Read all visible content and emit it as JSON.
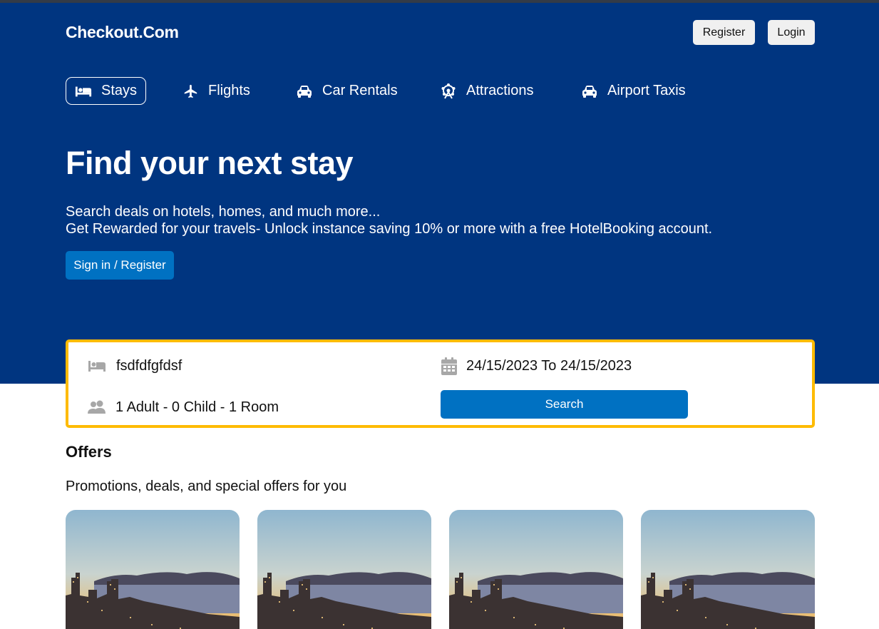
{
  "header": {
    "brand": "Checkout.Com",
    "register_label": "Register",
    "login_label": "Login"
  },
  "nav": {
    "items": [
      {
        "label": "Stays",
        "icon": "bed-icon",
        "active": true
      },
      {
        "label": "Flights",
        "icon": "plane-icon",
        "active": false
      },
      {
        "label": "Car Rentals",
        "icon": "car-icon",
        "active": false
      },
      {
        "label": "Attractions",
        "icon": "ferris-wheel-icon",
        "active": false
      },
      {
        "label": "Airport Taxis",
        "icon": "taxi-icon",
        "active": false
      }
    ]
  },
  "hero": {
    "title": "Find your next stay",
    "subtitle_line1": "Search deals on hotels, homes, and much more...",
    "subtitle_line2": "Get Rewarded for your travels- Unlock instance saving 10% or more with a free HotelBooking account.",
    "signin_label": "Sign in / Register"
  },
  "search": {
    "destination_value": "fsdfdfgfdsf",
    "dates_text": "24/15/2023 To 24/15/2023",
    "guests_text": "1 Adult - 0 Child - 1 Room",
    "search_label": "Search"
  },
  "offers": {
    "title": "Offers",
    "subtitle": "Promotions, deals, and special offers for you",
    "card_count": 4
  },
  "colors": {
    "hero_bg": "#003580",
    "accent_blue": "#0071c2",
    "search_border": "#febb02"
  }
}
